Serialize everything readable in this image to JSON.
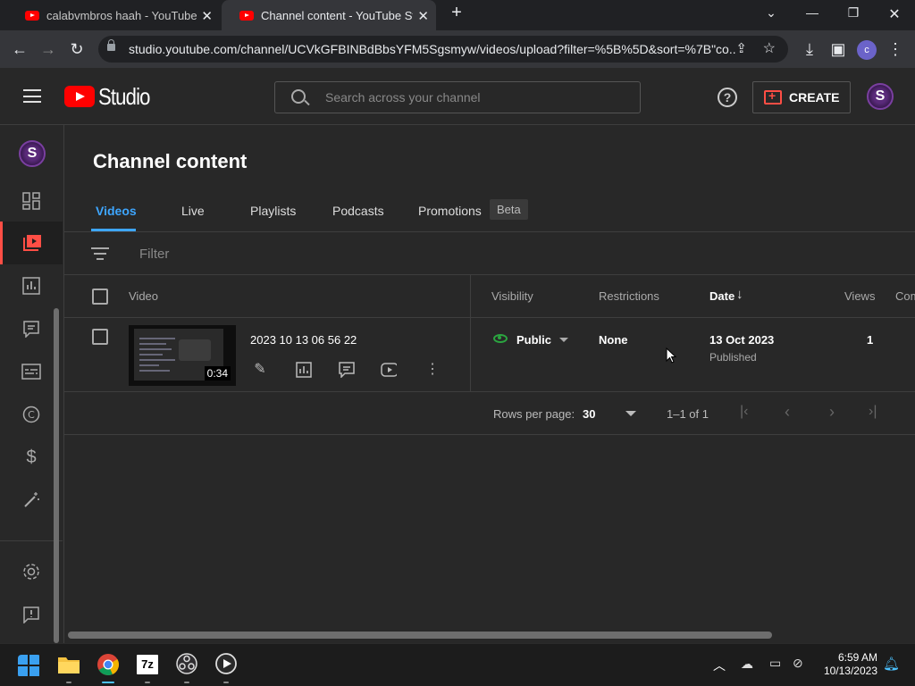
{
  "browser": {
    "tabs": [
      {
        "title": "calabvmbros haah - YouTube",
        "active": false
      },
      {
        "title": "Channel content - YouTube Stud",
        "active": true
      }
    ],
    "new_tab": "+",
    "url": "studio.youtube.com/channel/UCVkGFBINBdBbsYFM5Sgsmyw/videos/upload?filter=%5B%5D&sort=%7B\"co...",
    "profile_initial": "c"
  },
  "header": {
    "logo_text": "Studio",
    "search_placeholder": "Search across your channel",
    "help": "?",
    "create_label": "CREATE",
    "avatar_initial": "S"
  },
  "sidebar": {
    "avatar_initial": "S",
    "items": [
      "dashboard-icon",
      "content-icon",
      "analytics-icon",
      "comments-icon",
      "subtitles-icon",
      "copyright-icon",
      "earn-icon",
      "customization-icon",
      "settings-icon",
      "feedback-icon"
    ]
  },
  "main": {
    "title": "Channel content",
    "tabs": [
      {
        "label": "Videos",
        "active": true
      },
      {
        "label": "Live",
        "active": false
      },
      {
        "label": "Playlists",
        "active": false
      },
      {
        "label": "Podcasts",
        "active": false
      },
      {
        "label": "Promotions",
        "active": false
      }
    ],
    "beta_badge": "Beta",
    "filter_placeholder": "Filter",
    "columns": [
      "Video",
      "Visibility",
      "Restrictions",
      "Date",
      "Views",
      "Com"
    ],
    "rows": [
      {
        "title": "2023 10 13 06 56 22",
        "duration": "0:34",
        "visibility": "Public",
        "restrictions": "None",
        "date": "13 Oct 2023",
        "date_status": "Published",
        "views": "1"
      }
    ],
    "pagination": {
      "rows_per_page_label": "Rows per page:",
      "rows_per_page": "30",
      "range": "1–1 of 1"
    }
  },
  "taskbar": {
    "time": "6:59 AM",
    "date": "10/13/2023",
    "apps": [
      "windows-start-icon",
      "file-explorer-icon",
      "chrome-icon",
      "7zip-icon",
      "obs-icon",
      "media-player-icon"
    ],
    "sevenzip_label": "7z"
  },
  "colors": {
    "accent": "#3ea6ff",
    "brand_red": "#ff0000",
    "public_green": "#2ba640",
    "background": "#282828"
  }
}
